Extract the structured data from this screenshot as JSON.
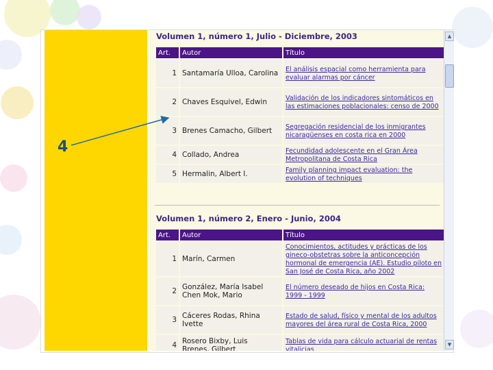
{
  "annotation": {
    "number": "4"
  },
  "section1": {
    "title": "Volumen 1, número 1, Julio - Diciembre, 2003",
    "headers": [
      "Art.",
      "Autor",
      "Título"
    ],
    "rows": [
      {
        "num": "1",
        "author": "Santamaría Ulloa, Carolina",
        "title": "El análisis espacial como herramienta para evaluar alarmas por cáncer"
      },
      {
        "num": "2",
        "author": "Chaves Esquivel, Edwin",
        "title": "Validación de los indicadores sintomáticos en las estimaciones poblacionales: censo de 2000"
      },
      {
        "num": "3",
        "author": "Brenes Camacho, Gilbert",
        "title": "Segregación residencial de los inmigrantes nicaragüenses en costa rica en 2000"
      },
      {
        "num": "4",
        "author": "Collado, Andrea",
        "title": "Fecundidad adolescente en el Gran Área Metropolitana de Costa Rica"
      },
      {
        "num": "5",
        "author": "Hermalin, Albert I.",
        "title": "Family planning impact evaluation: the evolution of techniques"
      }
    ]
  },
  "section2": {
    "title": "Volumen 1, número 2, Enero - Junio, 2004",
    "headers": [
      "Art.",
      "Autor",
      "Título"
    ],
    "rows": [
      {
        "num": "1",
        "author": "Marín, Carmen",
        "title": "Conocimientos, actitudes y prácticas de los gineco-obstetras sobre la anticoncepción hormonal de emergencia (AE). Estudio piloto en San José de Costa Rica, año 2002"
      },
      {
        "num": "2",
        "author": "González, María Isabel\nChen Mok, Mario",
        "title": "El número deseado de hijos en Costa Rica: 1999 - 1999"
      },
      {
        "num": "3",
        "author": "Cáceres Rodas, Rhina Ivette",
        "title": "Estado de salud, físico y mental de los adultos mayores del área rural de Costa Rica, 2000"
      },
      {
        "num": "4",
        "author": "Rosero Bixby, Luis\nBrenes, Gilbert",
        "title": "Tablas de vida para cálculo actuarial de rentas vitalicias"
      }
    ]
  }
}
